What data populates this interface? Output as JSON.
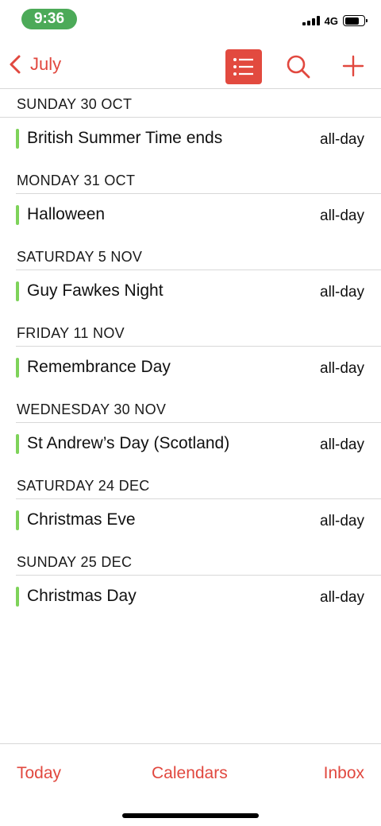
{
  "status_bar": {
    "time": "9:36",
    "network": "4G"
  },
  "nav": {
    "back_label": "July",
    "icons": [
      "chevron-left-icon",
      "list-icon",
      "search-icon",
      "plus-icon"
    ],
    "accent_color": "#e1483f"
  },
  "agenda": [
    {
      "date": "SUNDAY 30 OCT",
      "event": "British Summer Time ends",
      "time": "all-day"
    },
    {
      "date": "MONDAY 31 OCT",
      "event": "Halloween",
      "time": "all-day"
    },
    {
      "date": "SATURDAY 5 NOV",
      "event": "Guy Fawkes Night",
      "time": "all-day"
    },
    {
      "date": "FRIDAY 11 NOV",
      "event": "Remembrance Day",
      "time": "all-day"
    },
    {
      "date": "WEDNESDAY 30 NOV",
      "event": "St Andrew’s Day (Scotland)",
      "time": "all-day"
    },
    {
      "date": "SATURDAY 24 DEC",
      "event": "Christmas Eve",
      "time": "all-day"
    },
    {
      "date": "SUNDAY 25 DEC",
      "event": "Christmas Day",
      "time": "all-day"
    }
  ],
  "event_color": "#7ed35a",
  "toolbar": {
    "today": "Today",
    "calendars": "Calendars",
    "inbox": "Inbox"
  }
}
